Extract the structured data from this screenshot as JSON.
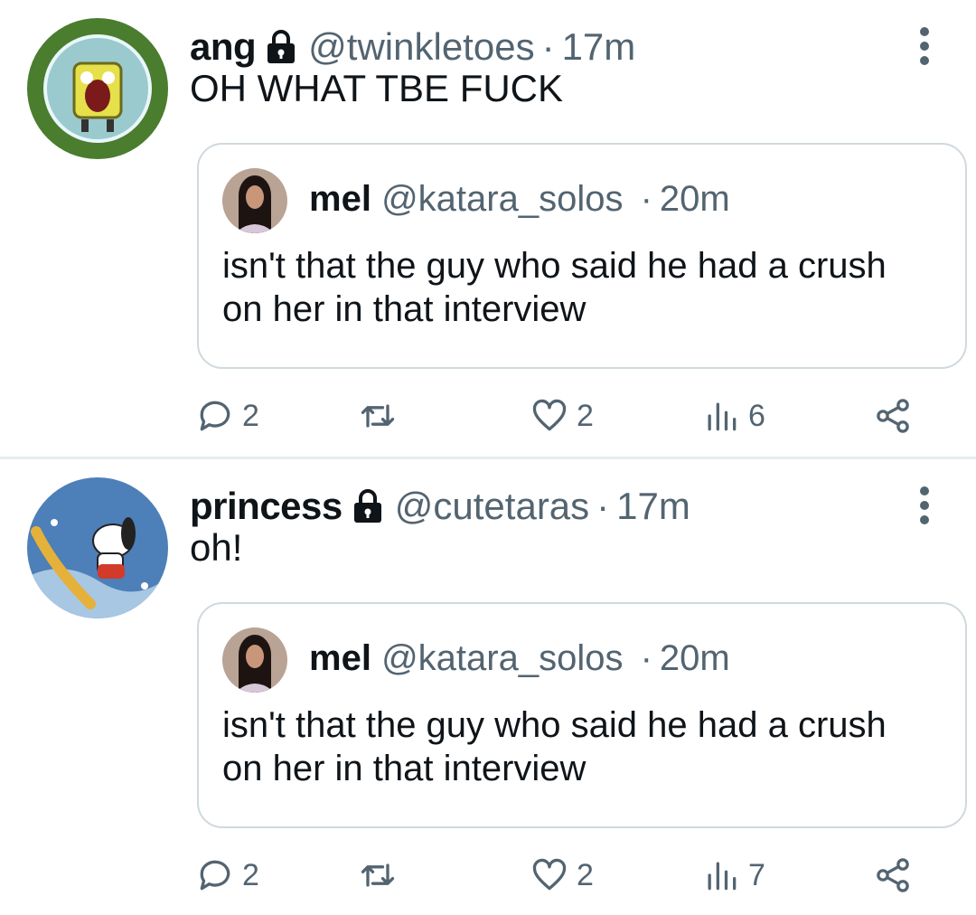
{
  "tweets": [
    {
      "author_name": "ang",
      "author_handle": "@twinkletoes",
      "separator": "·",
      "time": "17m",
      "text": "OH WHAT TBE FUCK",
      "avatar_icon": "spongebob-avatar",
      "quoted": {
        "author_name": "mel",
        "author_handle": "@katara_solos",
        "separator": "·",
        "time": "20m",
        "text": "isn't that the guy who said he had a crush on her in that interview"
      },
      "actions": {
        "replies": "2",
        "retweets": "",
        "likes": "2",
        "views": "6"
      }
    },
    {
      "author_name": "princess",
      "author_handle": "@cutetaras",
      "separator": "·",
      "time": "17m",
      "text": "oh!",
      "avatar_icon": "snoopy-avatar",
      "quoted": {
        "author_name": "mel",
        "author_handle": "@katara_solos",
        "separator": "·",
        "time": "20m",
        "text": "isn't that the guy who said he had a crush on her in that interview"
      },
      "actions": {
        "replies": "2",
        "retweets": "",
        "likes": "2",
        "views": "7"
      }
    }
  ],
  "colors": {
    "text": "#0f1419",
    "secondary": "#536471",
    "border": "#cfd9de",
    "divider": "#e6ecf0"
  }
}
